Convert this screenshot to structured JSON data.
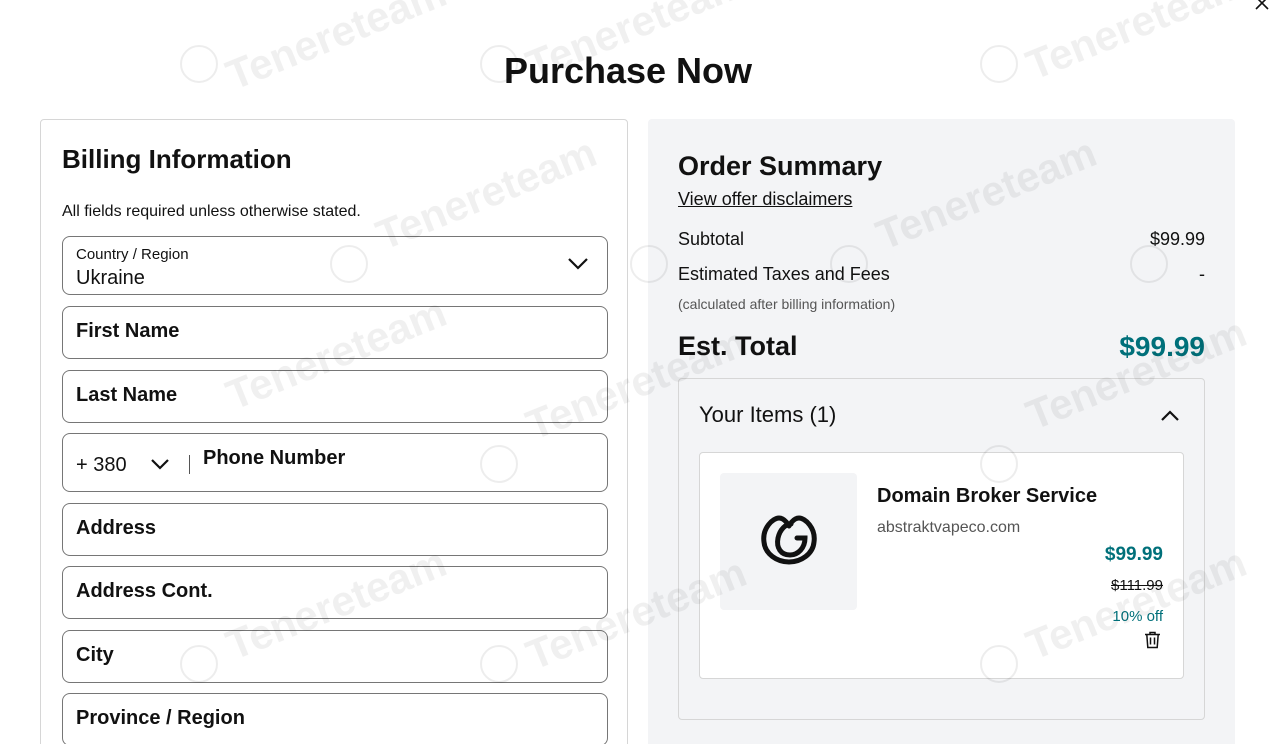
{
  "page": {
    "title": "Purchase Now"
  },
  "billing": {
    "heading": "Billing Information",
    "note": "All fields required unless otherwise stated.",
    "country": {
      "label": "Country / Region",
      "value": "Ukraine"
    },
    "first_name": "First Name",
    "last_name": "Last Name",
    "phone": {
      "code": "+ 380",
      "placeholder": "Phone Number"
    },
    "address": "Address",
    "address_cont": "Address Cont.",
    "city": "City",
    "province": "Province / Region"
  },
  "summary": {
    "heading": "Order Summary",
    "disclaimer_link": "View offer disclaimers",
    "subtotal_label": "Subtotal",
    "subtotal_value": "$99.99",
    "taxes_label": "Estimated Taxes and Fees",
    "taxes_value": "-",
    "calc_note": "(calculated after billing information)",
    "total_label": "Est. Total",
    "total_value": "$99.99"
  },
  "items": {
    "heading": "Your Items (1)",
    "list": [
      {
        "name": "Domain Broker Service",
        "domain": "abstraktvapeco.com",
        "price": "$99.99",
        "old_price": "$111.99",
        "discount": "10% off"
      }
    ]
  },
  "icons": {
    "close": "close-icon",
    "country_chevron": "chevron-down-icon",
    "phone_chevron": "chevron-down-icon",
    "items_collapse": "chevron-up-icon",
    "product_logo": "godaddy-logo",
    "delete": "trash-icon"
  },
  "watermark": "Tenereteam",
  "colors": {
    "accent": "#00707a",
    "panel": "#f3f4f6",
    "border": "#767676"
  }
}
